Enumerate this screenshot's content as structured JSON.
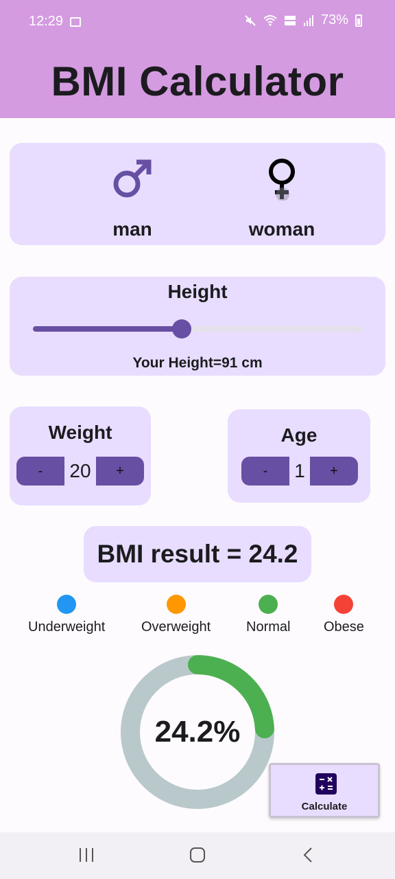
{
  "status_bar": {
    "time": "12:29",
    "battery": "73%"
  },
  "app": {
    "title": "BMI Calculator"
  },
  "gender": {
    "man_label": "man",
    "woman_label": "woman",
    "man_symbol_color": "#6750a4",
    "woman_symbol_color": "#000000"
  },
  "height": {
    "title": "Height",
    "value_text": "Your Height=91 cm",
    "slider_fraction": 0.45
  },
  "weight": {
    "title": "Weight",
    "minus": "-",
    "value": "20",
    "plus": "+"
  },
  "age": {
    "title": "Age",
    "minus": "-",
    "value": "1",
    "plus": "+"
  },
  "result": {
    "text": "BMI result = 24.2"
  },
  "legend": [
    {
      "label": "Underweight",
      "color": "#2196f3"
    },
    {
      "label": "Overweight",
      "color": "#ff9800"
    },
    {
      "label": "Normal",
      "color": "#4caf50"
    },
    {
      "label": "Obese",
      "color": "#f44336"
    }
  ],
  "gauge": {
    "text": "24.2%",
    "percent": 24.2,
    "active_color": "#4caf50",
    "track_color": "#b9c9cb"
  },
  "fab": {
    "label": "Calculate",
    "icon": "calculator-icon"
  },
  "nav": {
    "icons": [
      "recents-icon",
      "home-icon",
      "back-icon"
    ]
  },
  "colors": {
    "appbar": "#d49be0",
    "card": "#e9ddff",
    "primary": "#6750a4"
  }
}
